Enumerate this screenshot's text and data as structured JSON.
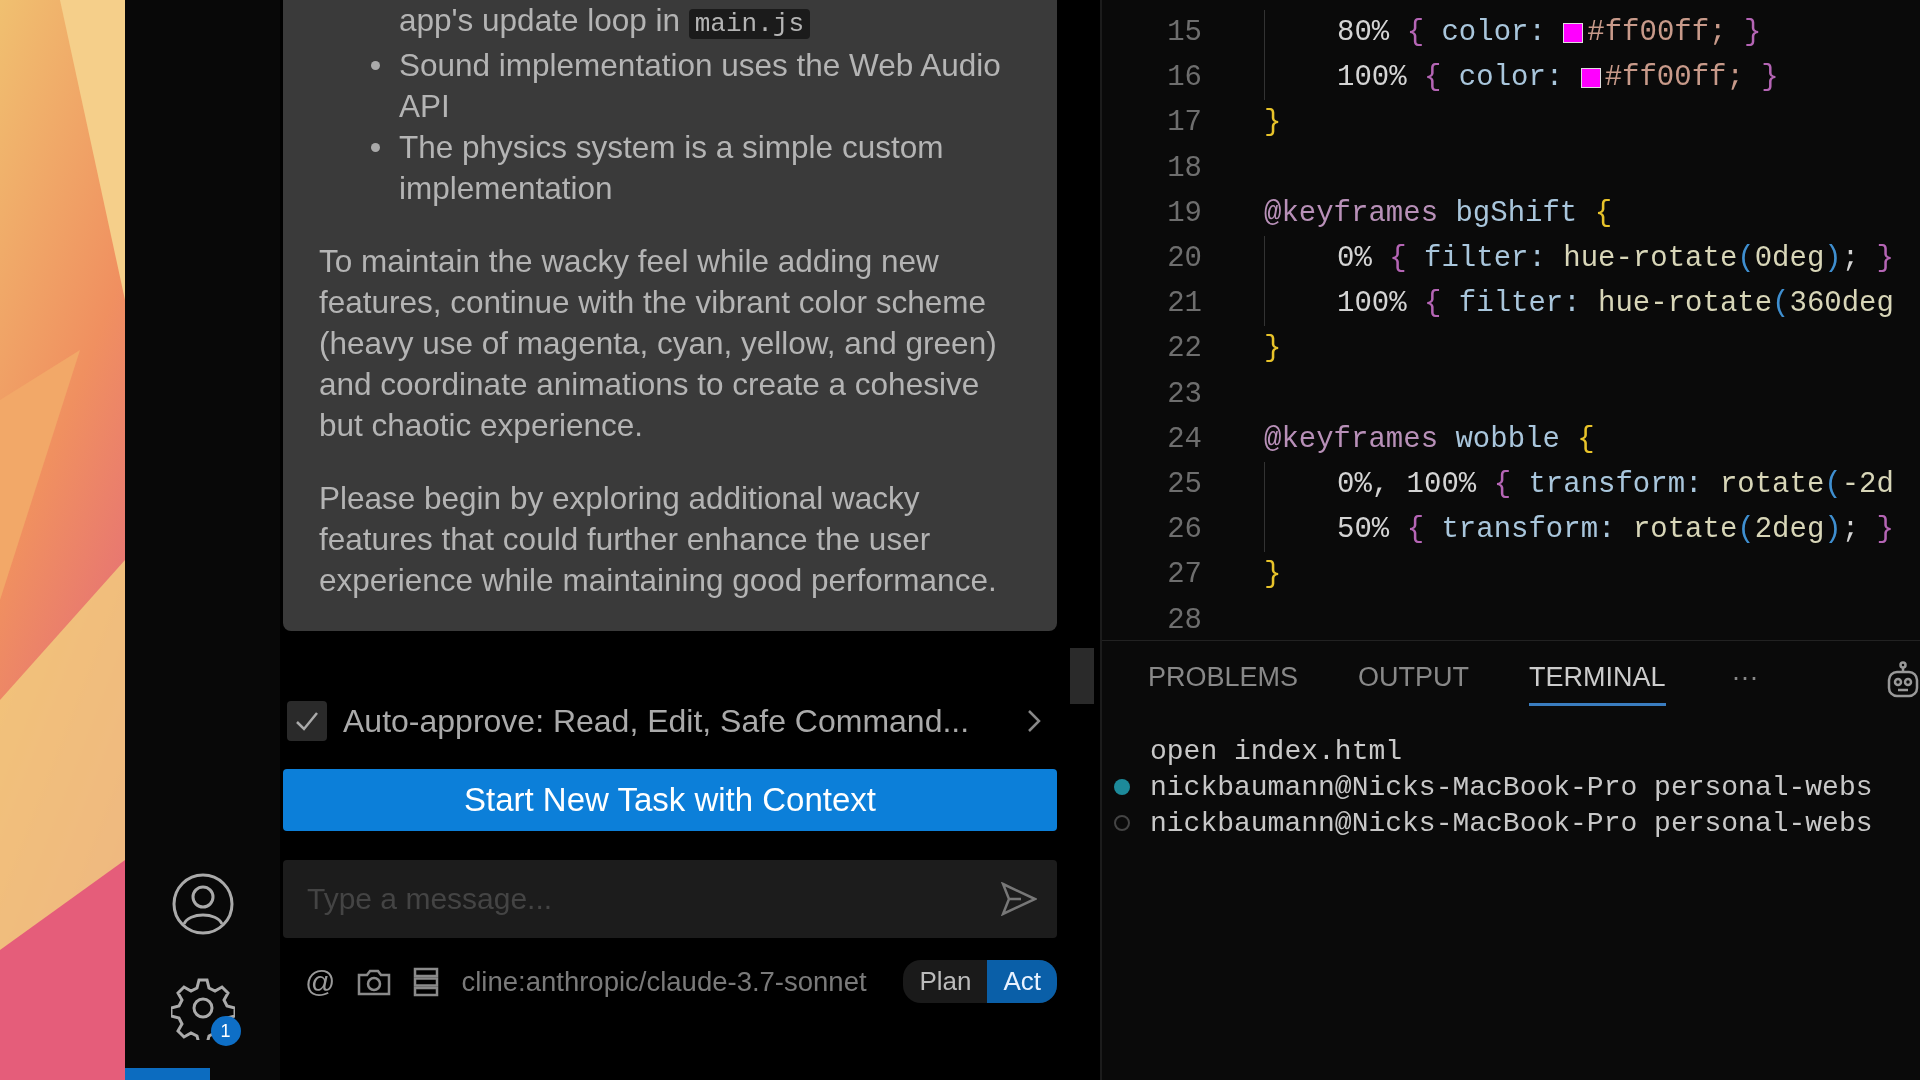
{
  "activity_bar": {
    "settings_badge": "1"
  },
  "chat": {
    "message": {
      "continuation": {
        "text": "app's update loop in",
        "code": "main.js"
      },
      "bullets": [
        "Sound implementation uses the Web Audio API",
        "The physics system is a simple custom implementation"
      ],
      "paragraphs": [
        "To maintain the wacky feel while adding new features, continue with the vibrant color scheme (heavy use of magenta, cyan, yellow, and green) and coordinate animations to create a cohesive but chaotic experience.",
        "Please begin by exploring additional wacky features that could further enhance the user experience while maintaining good performance."
      ]
    },
    "auto_approve": {
      "checked": true,
      "text": "Auto-approve: Read, Edit, Safe Command..."
    },
    "new_task_button": "Start New Task with Context",
    "input": {
      "placeholder": "Type a message..."
    },
    "toolbar": {
      "mention": "@",
      "model": "cline:anthropic/claude-3.7-sonnet",
      "modes": [
        {
          "label": "Plan",
          "selected": false
        },
        {
          "label": "Act",
          "selected": true
        }
      ]
    }
  },
  "editor": {
    "lines": [
      {
        "number": "15",
        "indented": true,
        "tokens": [
          {
            "kind": "plain",
            "text": "80% "
          },
          {
            "kind": "brace2",
            "text": "{"
          },
          {
            "kind": "prop",
            "text": " color: "
          },
          {
            "kind": "swatch",
            "color": "#ff00ff"
          },
          {
            "kind": "hex",
            "text": "#ff00ff;"
          },
          {
            "kind": "brace2",
            "text": " }"
          }
        ]
      },
      {
        "number": "16",
        "indented": true,
        "tokens": [
          {
            "kind": "plain",
            "text": "100% "
          },
          {
            "kind": "brace2",
            "text": "{"
          },
          {
            "kind": "prop",
            "text": " color: "
          },
          {
            "kind": "swatch",
            "color": "#ff00ff"
          },
          {
            "kind": "hex",
            "text": "#ff00ff;"
          },
          {
            "kind": "brace2",
            "text": " }"
          }
        ]
      },
      {
        "number": "17",
        "indented": false,
        "tokens": [
          {
            "kind": "brace1",
            "text": "}"
          }
        ]
      },
      {
        "number": "18"
      },
      {
        "number": "19",
        "indented": false,
        "tokens": [
          {
            "kind": "kw",
            "text": "@keyframes "
          },
          {
            "kind": "prop",
            "text": "bgShift "
          },
          {
            "kind": "brace1",
            "text": "{"
          }
        ]
      },
      {
        "number": "20",
        "indented": true,
        "tokens": [
          {
            "kind": "plain",
            "text": "0% "
          },
          {
            "kind": "brace2",
            "text": "{"
          },
          {
            "kind": "prop",
            "text": " filter: "
          },
          {
            "kind": "value",
            "text": "hue-rotate"
          },
          {
            "kind": "paren",
            "text": "("
          },
          {
            "kind": "value",
            "text": "0deg"
          },
          {
            "kind": "paren",
            "text": ")"
          },
          {
            "kind": "plain",
            "text": "; "
          },
          {
            "kind": "brace2",
            "text": "}"
          }
        ]
      },
      {
        "number": "21",
        "indented": true,
        "tokens": [
          {
            "kind": "plain",
            "text": "100% "
          },
          {
            "kind": "brace2",
            "text": "{"
          },
          {
            "kind": "prop",
            "text": " filter: "
          },
          {
            "kind": "value",
            "text": "hue-rotate"
          },
          {
            "kind": "paren",
            "text": "("
          },
          {
            "kind": "value",
            "text": "360deg"
          }
        ]
      },
      {
        "number": "22",
        "indented": false,
        "tokens": [
          {
            "kind": "brace1",
            "text": "}"
          }
        ]
      },
      {
        "number": "23"
      },
      {
        "number": "24",
        "indented": false,
        "tokens": [
          {
            "kind": "kw",
            "text": "@keyframes "
          },
          {
            "kind": "prop",
            "text": "wobble "
          },
          {
            "kind": "brace1",
            "text": "{"
          }
        ]
      },
      {
        "number": "25",
        "indented": true,
        "tokens": [
          {
            "kind": "plain",
            "text": "0%, 100% "
          },
          {
            "kind": "brace2",
            "text": "{"
          },
          {
            "kind": "prop",
            "text": " transform: "
          },
          {
            "kind": "value",
            "text": "rotate"
          },
          {
            "kind": "paren",
            "text": "("
          },
          {
            "kind": "value",
            "text": "-2d"
          }
        ]
      },
      {
        "number": "26",
        "indented": true,
        "tokens": [
          {
            "kind": "plain",
            "text": "50% "
          },
          {
            "kind": "brace2",
            "text": "{"
          },
          {
            "kind": "prop",
            "text": " transform: "
          },
          {
            "kind": "value",
            "text": "rotate"
          },
          {
            "kind": "paren",
            "text": "("
          },
          {
            "kind": "value",
            "text": "2deg"
          },
          {
            "kind": "paren",
            "text": ")"
          },
          {
            "kind": "plain",
            "text": "; "
          },
          {
            "kind": "brace2",
            "text": "}"
          }
        ]
      },
      {
        "number": "27",
        "indented": false,
        "tokens": [
          {
            "kind": "brace1",
            "text": "}"
          }
        ]
      },
      {
        "number": "28"
      }
    ]
  },
  "panel": {
    "tabs": [
      {
        "label": "PROBLEMS",
        "selected": false
      },
      {
        "label": "OUTPUT",
        "selected": false
      },
      {
        "label": "TERMINAL",
        "selected": true
      }
    ],
    "more": "···",
    "terminal": [
      {
        "kind": "plain",
        "text": "open index.html"
      },
      {
        "kind": "filled",
        "text": "nickbaumann@Nicks-MacBook-Pro personal-webs"
      },
      {
        "kind": "hollow",
        "text": "nickbaumann@Nicks-MacBook-Pro personal-webs"
      }
    ]
  }
}
